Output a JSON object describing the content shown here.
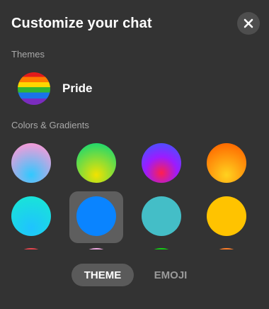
{
  "header": {
    "title": "Customize your chat",
    "close_icon": "close-icon"
  },
  "themes": {
    "label": "Themes",
    "items": [
      {
        "name": "Pride",
        "selected": false
      }
    ]
  },
  "colors": {
    "label": "Colors & Gradients",
    "swatches": [
      {
        "name": "pink-blue-gradient",
        "colors": [
          "#f59bd8",
          "#2fc9ff"
        ]
      },
      {
        "name": "green-yellow-gradient",
        "colors": [
          "#22d86b",
          "#f2e200"
        ]
      },
      {
        "name": "blue-purple-red-gradient",
        "colors": [
          "#3a5bff",
          "#9b1cff",
          "#ff1f4e"
        ]
      },
      {
        "name": "orange-yellow-gradient",
        "colors": [
          "#ff6a00",
          "#ffd21f"
        ]
      },
      {
        "name": "cyan-gradient",
        "colors": [
          "#19e3d8",
          "#1fc3ff"
        ]
      },
      {
        "name": "blue",
        "colors": [
          "#0a84ff"
        ],
        "selected": true
      },
      {
        "name": "teal",
        "colors": [
          "#44bec7"
        ]
      },
      {
        "name": "yellow",
        "colors": [
          "#ffc300"
        ]
      },
      {
        "name": "red",
        "colors": [
          "#e8454e"
        ]
      },
      {
        "name": "light-pink",
        "colors": [
          "#f2a9e3"
        ]
      },
      {
        "name": "green",
        "colors": [
          "#13cf13"
        ]
      },
      {
        "name": "orange",
        "colors": [
          "#ff7e29"
        ]
      }
    ]
  },
  "tabs": [
    {
      "label": "THEME",
      "active": true
    },
    {
      "label": "EMOJI",
      "active": false
    }
  ]
}
